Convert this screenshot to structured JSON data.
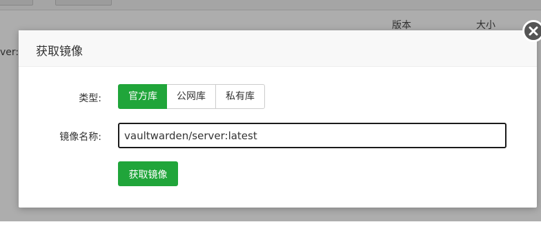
{
  "background": {
    "columns": {
      "version": "版本",
      "size": "大小"
    },
    "row_fragment": "ver:l"
  },
  "modal": {
    "title": "获取镜像",
    "type_label": "类型:",
    "registry_options": [
      "官方库",
      "公网库",
      "私有库"
    ],
    "selected_option": "官方库",
    "name_label": "镜像名称:",
    "image_name_value": "vaultwarden/server:latest",
    "submit_label": "获取镜像",
    "accent_color": "#20a53a"
  }
}
